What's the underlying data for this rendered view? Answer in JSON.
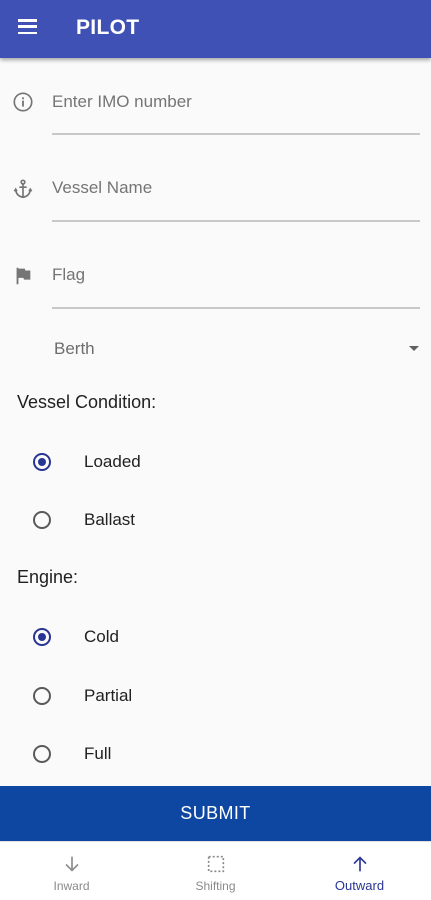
{
  "app": {
    "title": "PILOT"
  },
  "form": {
    "imo": {
      "placeholder": "Enter IMO number",
      "icon": "info-icon"
    },
    "vessel_name": {
      "placeholder": "Vessel Name",
      "icon": "anchor-icon"
    },
    "flag": {
      "placeholder": "Flag",
      "icon": "flag-icon"
    },
    "berth": {
      "value": "Berth"
    }
  },
  "vessel_condition": {
    "label": "Vessel Condition:",
    "options": [
      {
        "label": "Loaded",
        "checked": true
      },
      {
        "label": "Ballast",
        "checked": false
      }
    ]
  },
  "engine": {
    "label": "Engine:",
    "options": [
      {
        "label": "Cold",
        "checked": true
      },
      {
        "label": "Partial",
        "checked": false
      },
      {
        "label": "Full",
        "checked": false
      }
    ]
  },
  "submit_label": "SUBMIT",
  "bottom_nav": {
    "items": [
      {
        "label": "Inward",
        "icon": "arrow-down-icon",
        "active": false
      },
      {
        "label": "Shifting",
        "icon": "dashed-square-icon",
        "active": false
      },
      {
        "label": "Outward",
        "icon": "arrow-up-icon",
        "active": true
      }
    ]
  },
  "colors": {
    "appbar": "#3f51b5",
    "submit": "#0d47a1",
    "accent": "#283593"
  }
}
